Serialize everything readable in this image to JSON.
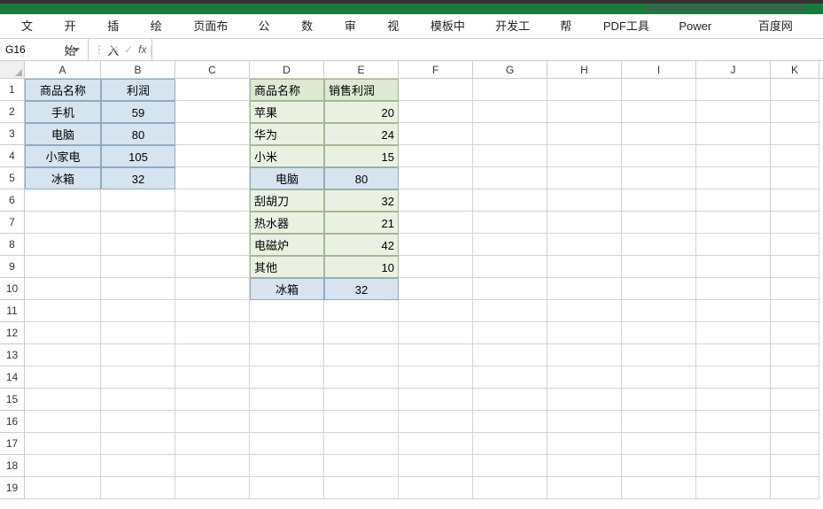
{
  "ribbon": {
    "tabs": [
      "文件",
      "开始",
      "插入",
      "绘图",
      "页面布局",
      "公式",
      "数据",
      "审阅",
      "视图",
      "模板中心",
      "开发工具",
      "帮助",
      "PDF工具集",
      "Power Pivot",
      "百度网盘"
    ]
  },
  "namebox": {
    "value": "G16"
  },
  "formula": {
    "value": ""
  },
  "columns": [
    "A",
    "B",
    "C",
    "D",
    "E",
    "F",
    "G",
    "H",
    "I",
    "J",
    "K"
  ],
  "rownums": [
    "1",
    "2",
    "3",
    "4",
    "5",
    "6",
    "7",
    "8",
    "9",
    "10",
    "11",
    "12",
    "13",
    "14",
    "15",
    "16",
    "17",
    "18",
    "19"
  ],
  "tableAB": {
    "headers": [
      "商品名称",
      "利润"
    ],
    "rows": [
      [
        "手机",
        "59"
      ],
      [
        "电脑",
        "80"
      ],
      [
        "小家电",
        "105"
      ],
      [
        "冰箱",
        "32"
      ]
    ]
  },
  "tableDE": {
    "headers": [
      "商品名称",
      "销售利润"
    ],
    "rows": [
      {
        "d": "苹果",
        "e": "20",
        "style": "green-lr"
      },
      {
        "d": "华为",
        "e": "24",
        "style": "green-lr"
      },
      {
        "d": "小米",
        "e": "15",
        "style": "green-lr"
      },
      {
        "d": "电脑",
        "e": "80",
        "style": "blue-cc"
      },
      {
        "d": "刮胡刀",
        "e": "32",
        "style": "green-lr"
      },
      {
        "d": "热水器",
        "e": "21",
        "style": "green-lr"
      },
      {
        "d": "电磁炉",
        "e": "42",
        "style": "green-lr"
      },
      {
        "d": "其他",
        "e": "10",
        "style": "green-lr"
      },
      {
        "d": "冰箱",
        "e": "32",
        "style": "blue-cc"
      }
    ]
  }
}
